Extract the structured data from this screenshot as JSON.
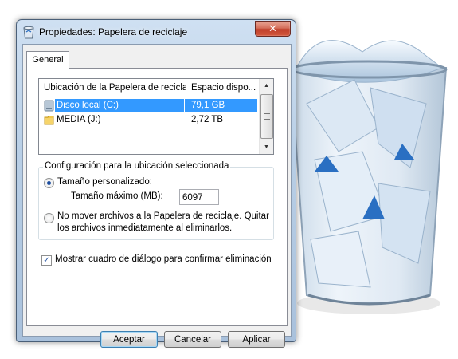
{
  "window": {
    "title": "Propiedades: Papelera de reciclaje",
    "close_label": "✕"
  },
  "tabs": [
    {
      "label": "General",
      "selected": true
    }
  ],
  "listview": {
    "columns": [
      "Ubicación de la Papelera de reciclaje",
      "Espacio dispo..."
    ],
    "rows": [
      {
        "name": "Disco local (C:)",
        "space": "79,1 GB",
        "icon": "drive-icon",
        "selected": true
      },
      {
        "name": "MEDIA (J:)",
        "space": "2,72 TB",
        "icon": "folder-icon",
        "selected": false
      }
    ]
  },
  "settings": {
    "group_title": "Configuración para la ubicación seleccionada",
    "custom_size_label": "Tamaño personalizado:",
    "max_size_label": "Tamaño máximo (MB):",
    "max_size_value": "6097",
    "no_move_line1": "No mover archivos a la Papelera de reciclaje. Quitar",
    "no_move_line2": "los archivos inmediatamente al eliminarlos.",
    "selected_option": "custom"
  },
  "confirm_delete": {
    "label": "Mostrar cuadro de diálogo para confirmar eliminación",
    "checked": true,
    "mark": "✓"
  },
  "buttons": {
    "ok": "Aceptar",
    "cancel": "Cancelar",
    "apply": "Aplicar"
  },
  "colors": {
    "selection": "#3399ff",
    "titlebar": "#b9cfe6",
    "close": "#c0402b"
  }
}
